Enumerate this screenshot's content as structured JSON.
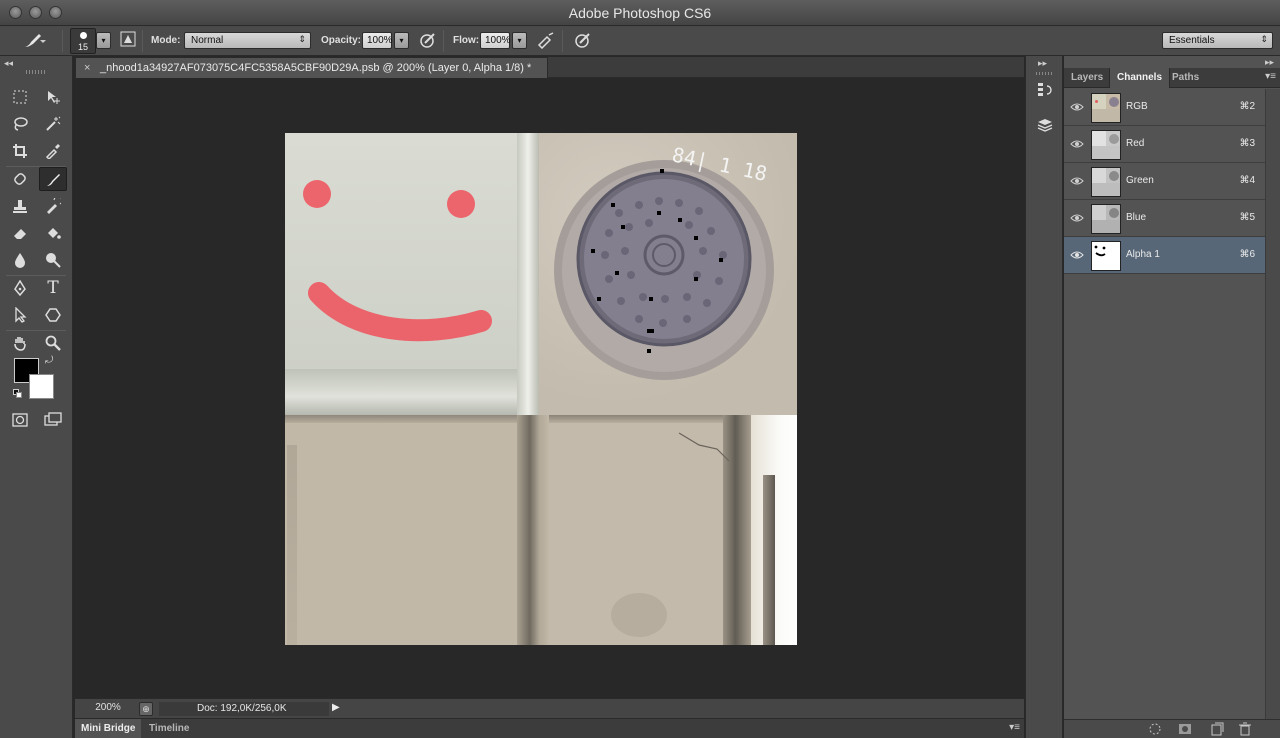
{
  "window": {
    "title": "Adobe Photoshop CS6"
  },
  "options_bar": {
    "brush_size": "15",
    "mode_label": "Mode:",
    "mode_value": "Normal",
    "opacity_label": "Opacity:",
    "opacity_value": "100%",
    "flow_label": "Flow:",
    "flow_value": "100%",
    "workspace_value": "Essentials"
  },
  "document": {
    "tab_title": "_nhood1a34927AF073075C4FC5358A5CBF90D29A.psb @ 200% (Layer 0, Alpha 1/8) *",
    "zoom": "200%",
    "doc_info": "Doc: 192,0K/256,0K",
    "cover_text": "84| 1 18"
  },
  "bottom_tabs": [
    "Mini Bridge",
    "Timeline"
  ],
  "panel": {
    "tabs": [
      "Layers",
      "Channels",
      "Paths"
    ],
    "active_tab": "Channels",
    "channels": [
      {
        "name": "RGB",
        "shortcut": "⌘2",
        "thumb": "rgb"
      },
      {
        "name": "Red",
        "shortcut": "⌘3",
        "thumb": "gray"
      },
      {
        "name": "Green",
        "shortcut": "⌘4",
        "thumb": "gray"
      },
      {
        "name": "Blue",
        "shortcut": "⌘5",
        "thumb": "gray"
      },
      {
        "name": "Alpha 1",
        "shortcut": "⌘6",
        "thumb": "alpha",
        "selected": true
      }
    ]
  },
  "colors": {
    "smiley_red": "#f0505a",
    "foreground": "#000000",
    "background": "#ffffff",
    "selection": "#586778"
  }
}
